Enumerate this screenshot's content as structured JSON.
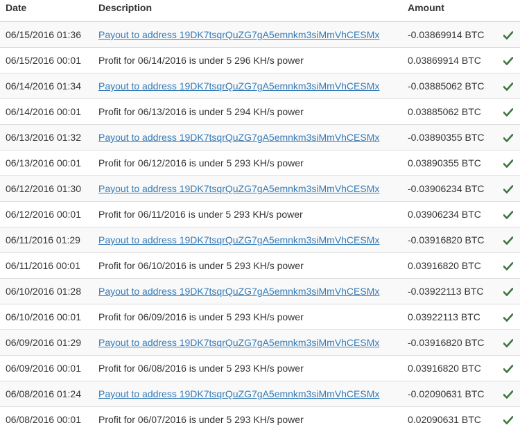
{
  "columns": {
    "date": "Date",
    "description": "Description",
    "amount": "Amount"
  },
  "colors": {
    "link": "#337ab7",
    "check": "#3c763d",
    "stripe": "#f9f9f9",
    "border": "#dddddd"
  },
  "status_icon": "check-icon",
  "rows": [
    {
      "date": "06/15/2016 01:36",
      "description": "Payout to address 19DK7tsqrQuZG7gA5emnkm3siMmVhCESMx",
      "amount": "-0.03869914 BTC",
      "link": true
    },
    {
      "date": "06/15/2016 00:01",
      "description": "Profit for 06/14/2016 is under 5 296 KH/s power",
      "amount": "0.03869914 BTC",
      "link": false
    },
    {
      "date": "06/14/2016 01:34",
      "description": "Payout to address 19DK7tsqrQuZG7gA5emnkm3siMmVhCESMx",
      "amount": "-0.03885062 BTC",
      "link": true
    },
    {
      "date": "06/14/2016 00:01",
      "description": "Profit for 06/13/2016 is under 5 294 KH/s power",
      "amount": "0.03885062 BTC",
      "link": false
    },
    {
      "date": "06/13/2016 01:32",
      "description": "Payout to address 19DK7tsqrQuZG7gA5emnkm3siMmVhCESMx",
      "amount": "-0.03890355 BTC",
      "link": true
    },
    {
      "date": "06/13/2016 00:01",
      "description": "Profit for 06/12/2016 is under 5 293 KH/s power",
      "amount": "0.03890355 BTC",
      "link": false
    },
    {
      "date": "06/12/2016 01:30",
      "description": "Payout to address 19DK7tsqrQuZG7gA5emnkm3siMmVhCESMx",
      "amount": "-0.03906234 BTC",
      "link": true
    },
    {
      "date": "06/12/2016 00:01",
      "description": "Profit for 06/11/2016 is under 5 293 KH/s power",
      "amount": "0.03906234 BTC",
      "link": false
    },
    {
      "date": "06/11/2016 01:29",
      "description": "Payout to address 19DK7tsqrQuZG7gA5emnkm3siMmVhCESMx",
      "amount": "-0.03916820 BTC",
      "link": true
    },
    {
      "date": "06/11/2016 00:01",
      "description": "Profit for 06/10/2016 is under 5 293 KH/s power",
      "amount": "0.03916820 BTC",
      "link": false
    },
    {
      "date": "06/10/2016 01:28",
      "description": "Payout to address 19DK7tsqrQuZG7gA5emnkm3siMmVhCESMx",
      "amount": "-0.03922113 BTC",
      "link": true
    },
    {
      "date": "06/10/2016 00:01",
      "description": "Profit for 06/09/2016 is under 5 293 KH/s power",
      "amount": "0.03922113 BTC",
      "link": false
    },
    {
      "date": "06/09/2016 01:29",
      "description": "Payout to address 19DK7tsqrQuZG7gA5emnkm3siMmVhCESMx",
      "amount": "-0.03916820 BTC",
      "link": true
    },
    {
      "date": "06/09/2016 00:01",
      "description": "Profit for 06/08/2016 is under 5 293 KH/s power",
      "amount": "0.03916820 BTC",
      "link": false
    },
    {
      "date": "06/08/2016 01:24",
      "description": "Payout to address 19DK7tsqrQuZG7gA5emnkm3siMmVhCESMx",
      "amount": "-0.02090631 BTC",
      "link": true
    },
    {
      "date": "06/08/2016 00:01",
      "description": "Profit for 06/07/2016 is under 5 293 KH/s power",
      "amount": "0.02090631 BTC",
      "link": false
    }
  ]
}
